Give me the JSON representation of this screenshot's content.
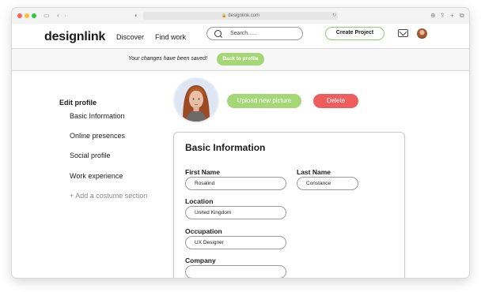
{
  "browser": {
    "url": "designlink.com",
    "traffic_colors": [
      "#ff5f57",
      "#febc2e",
      "#28c840"
    ]
  },
  "nav": {
    "logo": "designlink",
    "links": [
      "Discover",
      "Find work"
    ],
    "search_placeholder": "Search......",
    "create_label": "Create Project"
  },
  "banner": {
    "message": "Your changes have been saved!",
    "back_label": "Back to profile"
  },
  "sidebar": {
    "title": "Edit profile",
    "items": [
      "Basic Information",
      "Online presences",
      "Social profile",
      "Work experience"
    ],
    "add_label": "+ Add a costume section"
  },
  "photo_actions": {
    "upload_label": "Upload new picture",
    "delete_label": "Delete"
  },
  "form": {
    "title": "Basic Information",
    "first_name": {
      "label": "First Name",
      "value": "Rosalind"
    },
    "last_name": {
      "label": "Last Name",
      "value": "Constance"
    },
    "location": {
      "label": "Location",
      "value": "United Kingdom"
    },
    "occupation": {
      "label": "Occupation",
      "value": "UX Designer"
    },
    "company": {
      "label": "Company",
      "value": ""
    }
  },
  "colors": {
    "accent_green": "#a6d777",
    "create_border": "#8ccf6b",
    "delete_red": "#ee5e5e"
  }
}
